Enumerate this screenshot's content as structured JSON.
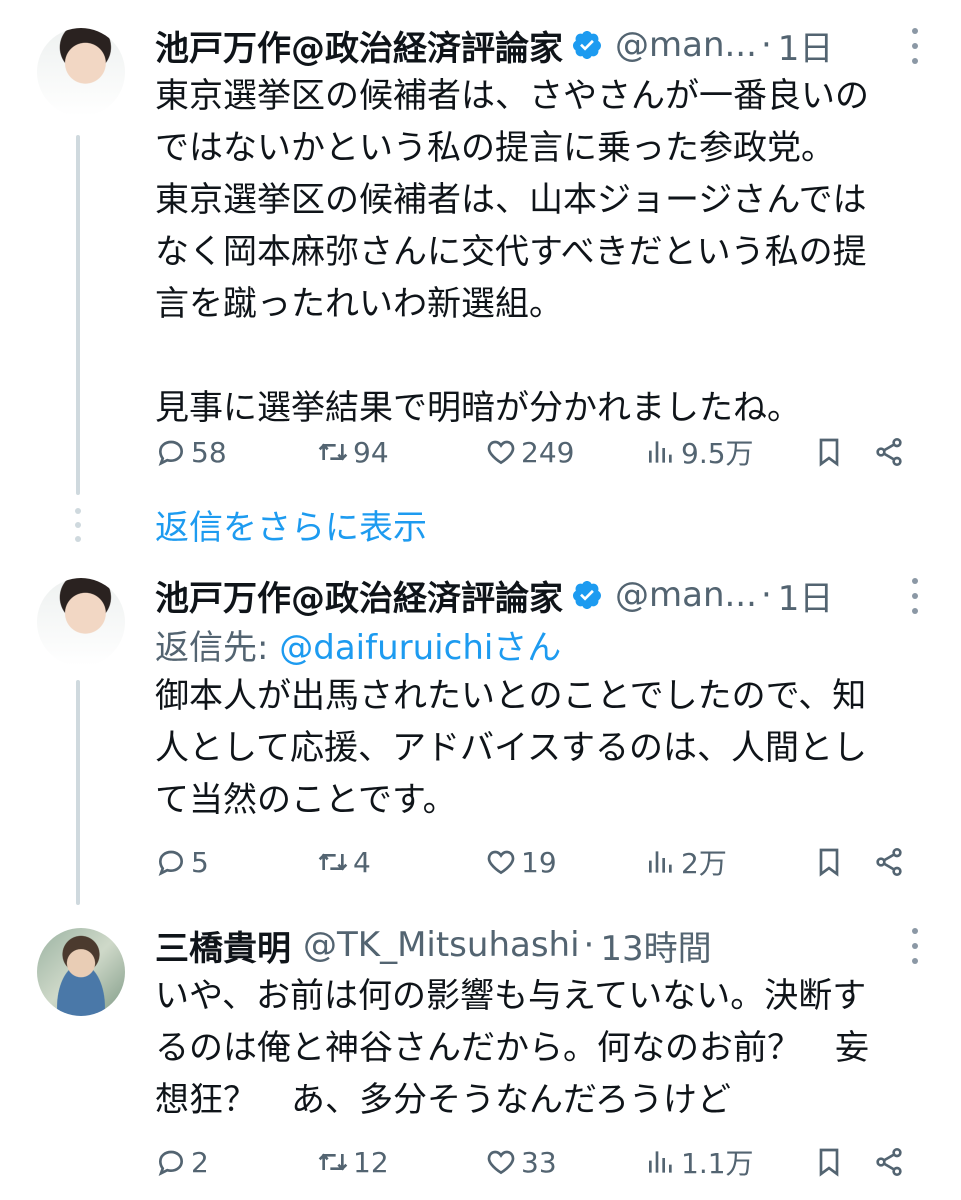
{
  "tweets": [
    {
      "name": "池戸万作@政治経済評論家",
      "handle": "@man...",
      "dot": "·",
      "time": "1日",
      "reply_prefix": "",
      "reply_mention": "",
      "text": "東京選挙区の候補者は、さやさんが一番良いの\nではないかという私の提言に乗った参政党。\n東京選挙区の候補者は、山本ジョージさんでは\nなく岡本麻弥さんに交代すべきだという私の提\n言を蹴ったれいわ新選組。\n\n見事に選挙結果で明暗が分かれましたね。",
      "replies": "58",
      "retweets": "94",
      "likes": "249",
      "views": "9.5万"
    },
    {
      "name": "池戸万作@政治経済評論家",
      "handle": "@man...",
      "dot": "·",
      "time": "1日",
      "reply_prefix": "返信先: ",
      "reply_mention": "@daifuruichiさん",
      "text": "御本人が出馬されたいとのことでしたので、知\n人として応援、アドバイスするのは、人間とし\nて当然のことです。",
      "replies": "5",
      "retweets": "4",
      "likes": "19",
      "views": "2万"
    },
    {
      "name": "三橋貴明",
      "handle": "@TK_Mitsuhashi",
      "dot": "·",
      "time": "13時間",
      "reply_prefix": "",
      "reply_mention": "",
      "text": "いや、お前は何の影響も与えていない。決断す\nるのは俺と神谷さんだから。何なのお前？　妄\n想狂？　あ、多分そうなんだろうけど",
      "replies": "2",
      "retweets": "12",
      "likes": "33",
      "views": "1.1万"
    }
  ],
  "show_more_replies": "返信をさらに表示",
  "colors": {
    "link": "#1d9bf0",
    "muted": "#536471",
    "verified": "#1d9bf0",
    "thread_line": "#cfd9de"
  },
  "icons": [
    "reply-icon",
    "retweet-icon",
    "like-icon",
    "views-icon",
    "bookmark-icon",
    "share-icon",
    "verified-icon",
    "more-icon"
  ]
}
